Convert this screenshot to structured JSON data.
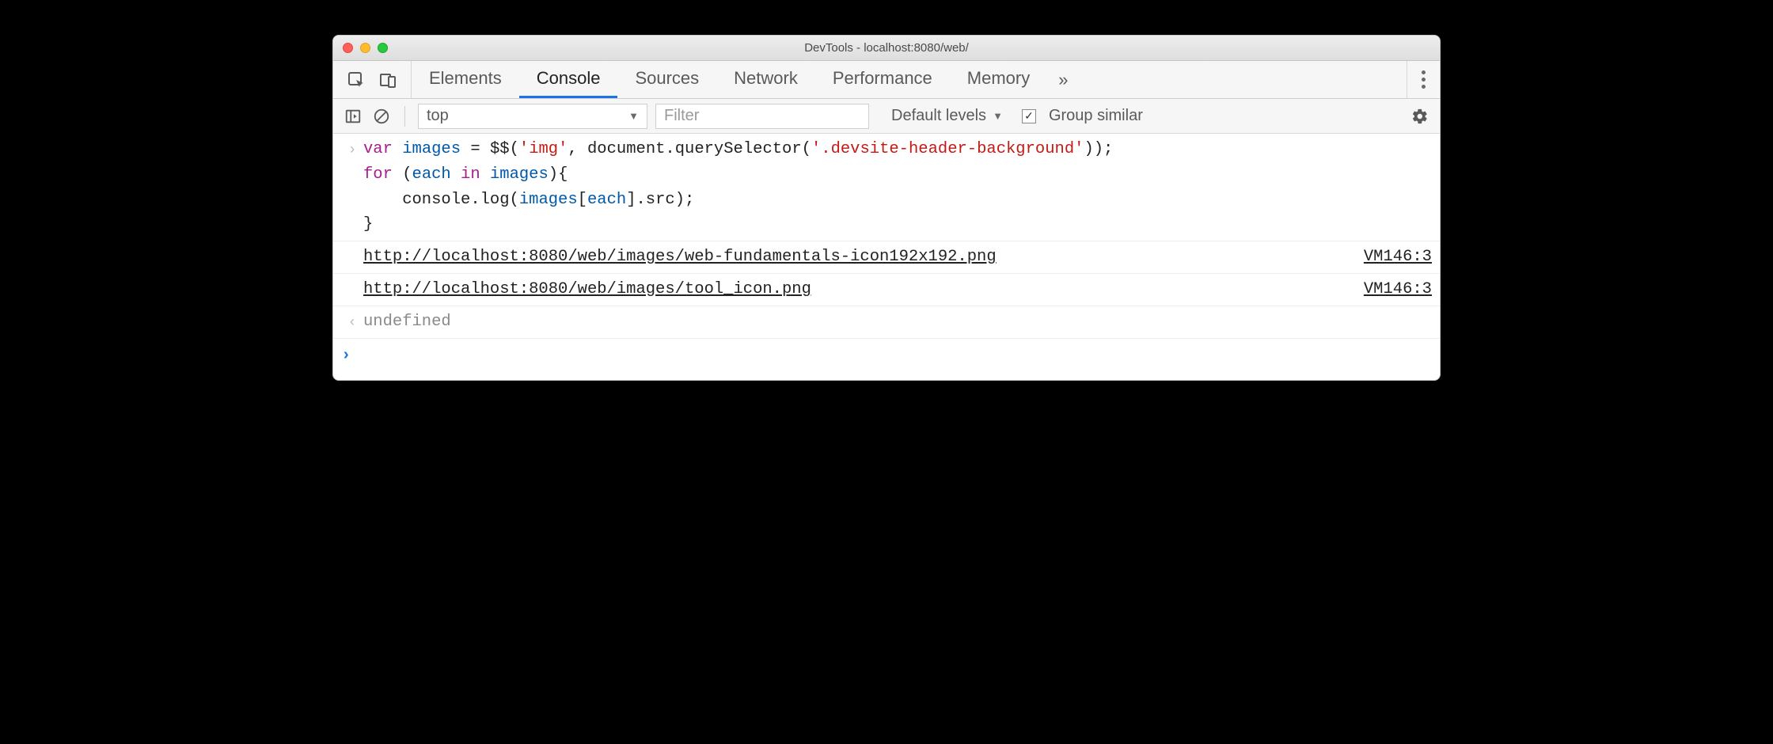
{
  "window": {
    "title": "DevTools - localhost:8080/web/"
  },
  "tabs": {
    "items": [
      "Elements",
      "Console",
      "Sources",
      "Network",
      "Performance",
      "Memory"
    ],
    "active_index": 1,
    "overflow_glyph": "»"
  },
  "toolbar": {
    "context": "top",
    "filter_placeholder": "Filter",
    "levels_label": "Default levels",
    "group_similar_label": "Group similar",
    "group_similar_checked": true
  },
  "console": {
    "input_code_html": "<span class='kw'>var</span> <span class='id'>images</span> <span class='op'>=</span> <span class='fn'>$$</span>(<span class='str'>'img'</span>, document.querySelector(<span class='str'>'.devsite-header-background'</span>));\n<span class='kw'>for</span> (<span class='id'>each</span> <span class='kw'>in</span> <span class='id'>images</span>){\n    console.log(<span class='id'>images</span>[<span class='id'>each</span>].src);\n}",
    "logs": [
      {
        "text": "http://localhost:8080/web/images/web-fundamentals-icon192x192.png",
        "source": "VM146:3"
      },
      {
        "text": "http://localhost:8080/web/images/tool_icon.png",
        "source": "VM146:3"
      }
    ],
    "return_value": "undefined",
    "prompt_glyph": "›"
  }
}
